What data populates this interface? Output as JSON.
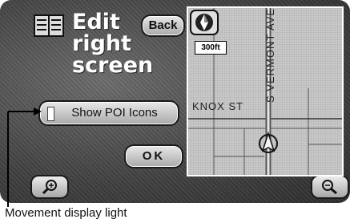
{
  "header": {
    "title_lines": [
      "Edit",
      "right",
      "screen"
    ],
    "back_label": "Back"
  },
  "options": {
    "poi_label": "Show POI Icons",
    "ok_label": "OK"
  },
  "map": {
    "scale_label": "300ft",
    "street_vertical": "S VERMONT AVE",
    "street_horizontal": "KNOX ST"
  },
  "annotation": {
    "caption": "Movement display light"
  }
}
